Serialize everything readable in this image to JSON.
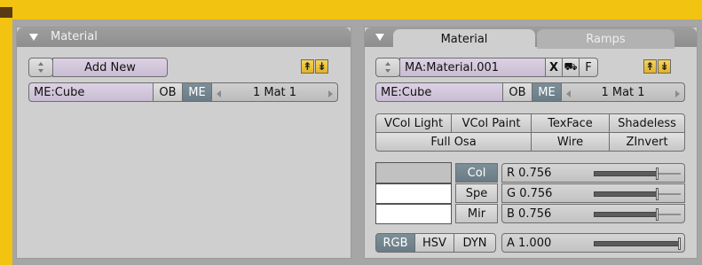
{
  "left_panel": {
    "header_title": "Material",
    "add_new_label": "Add New",
    "mesh_field": "ME:Cube",
    "ob_label": "OB",
    "me_label": "ME",
    "mat_index": "1 Mat 1"
  },
  "right_panel": {
    "tabs": [
      "Material",
      "Ramps"
    ],
    "material_name": "MA:Material.001",
    "x_label": "X",
    "fake_user_label": "F",
    "mesh_field": "ME:Cube",
    "ob_label": "OB",
    "me_label": "ME",
    "mat_index": "1 Mat 1",
    "toggles_row1": [
      "VCol Light",
      "VCol Paint",
      "TexFace",
      "Shadeless"
    ],
    "toggles_row2": [
      "Full Osa",
      "Wire",
      "ZInvert"
    ],
    "color_buttons": [
      "Col",
      "Spe",
      "Mir"
    ],
    "sliders": [
      {
        "label": "R 0.756",
        "value": 0.756
      },
      {
        "label": "G 0.756",
        "value": 0.756
      },
      {
        "label": "B 0.756",
        "value": 0.756
      }
    ],
    "color_modes": [
      "RGB",
      "HSV",
      "DYN"
    ],
    "alpha": {
      "label": "A 1.000",
      "value": 1.0
    }
  },
  "colors": {
    "frame": "#f2c311",
    "workspace": "#a6a6a6",
    "panel": "#cfcfcf",
    "selected": "#6a7c86",
    "purple_field": "#c9bcd3"
  }
}
